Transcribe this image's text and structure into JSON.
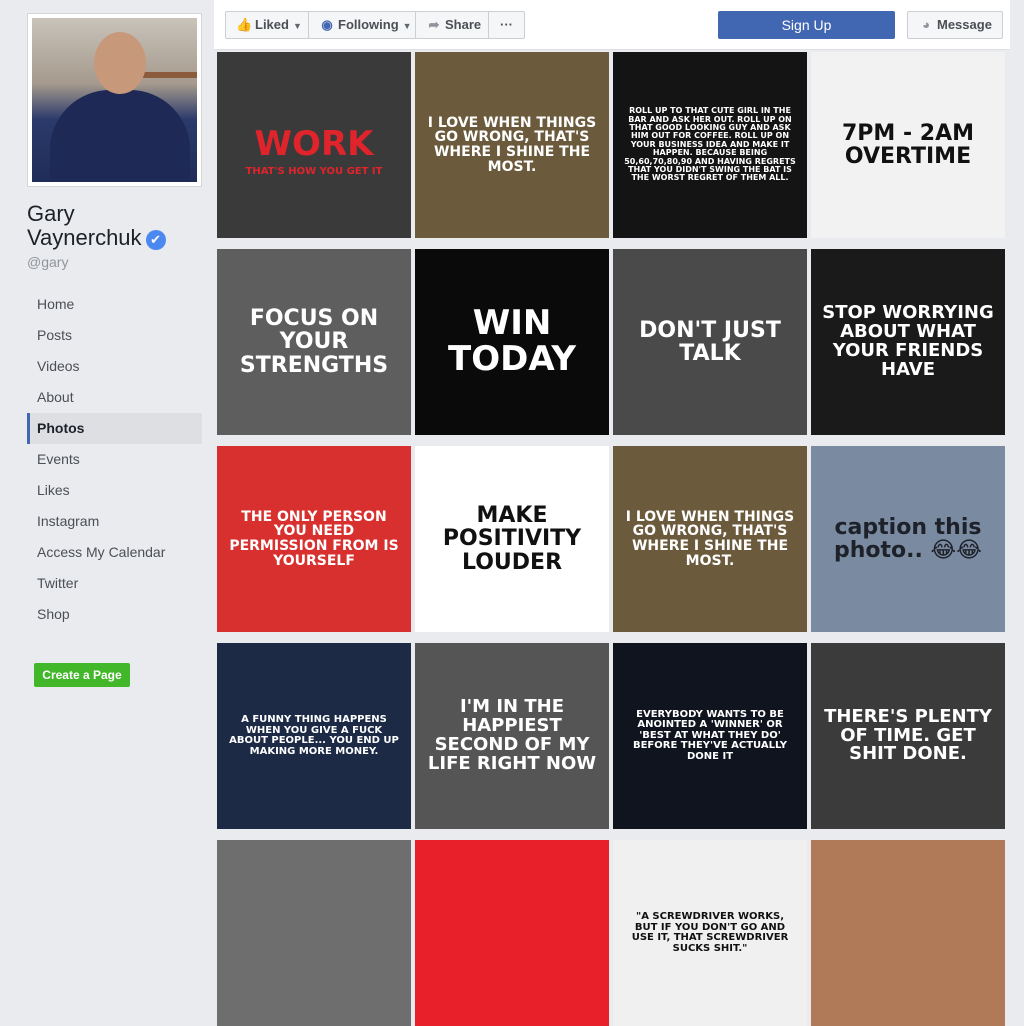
{
  "page": {
    "name_first": "Gary",
    "name_last": "Vaynerchuk",
    "handle": "@gary",
    "verified_glyph": "✔"
  },
  "nav": [
    {
      "label": "Home"
    },
    {
      "label": "Posts"
    },
    {
      "label": "Videos"
    },
    {
      "label": "About"
    },
    {
      "label": "Photos",
      "active": true
    },
    {
      "label": "Events"
    },
    {
      "label": "Likes"
    },
    {
      "label": "Instagram"
    },
    {
      "label": "Access My Calendar"
    },
    {
      "label": "Twitter"
    },
    {
      "label": "Shop"
    }
  ],
  "create_page_label": "Create a Page",
  "toolbar": {
    "liked_label": "Liked",
    "following_label": "Following",
    "share_label": "Share",
    "more_label": "···",
    "signup_label": "Sign Up",
    "message_label": "Message"
  },
  "photos": [
    {
      "text": "WORK",
      "sub": "THAT'S HOW YOU GET IT",
      "bg": "#3a3a3a",
      "color": "#e0242b"
    },
    {
      "text": "I LOVE WHEN THINGS GO WRONG, THAT'S WHERE I SHINE THE MOST.",
      "bg": "#6b5a3c",
      "color": "#ffffff"
    },
    {
      "text": "ROLL UP TO THAT CUTE GIRL IN THE BAR AND ASK HER OUT. ROLL UP ON THAT GOOD LOOKING GUY AND ASK HIM OUT FOR COFFEE. ROLL UP ON YOUR BUSINESS IDEA AND MAKE IT HAPPEN. BECAUSE BEING 50,60,70,80,90 AND HAVING REGRETS THAT YOU DIDN'T SWING THE BAT IS THE WORST REGRET OF THEM ALL.",
      "bg": "#141414",
      "color": "#ffffff"
    },
    {
      "text": "7PM - 2AM OVERTIME",
      "bg": "#f2f2f2",
      "color": "#111111"
    },
    {
      "text": "FOCUS ON YOUR STRENGTHS",
      "bg": "#5e5e5e",
      "color": "#ffffff"
    },
    {
      "text": "WIN TODAY",
      "bg": "#0a0a0a",
      "color": "#ffffff"
    },
    {
      "text": "DON'T JUST TALK",
      "bg": "#4a4a4a",
      "color": "#ffffff"
    },
    {
      "text": "STOP WORRYING ABOUT WHAT YOUR FRIENDS HAVE",
      "bg": "#1a1a1a",
      "color": "#ffffff"
    },
    {
      "text": "THE ONLY PERSON YOU NEED PERMISSION FROM IS YOURSELF",
      "bg": "#d8302e",
      "color": "#ffffff"
    },
    {
      "text": "MAKE POSITIVITY LOUDER",
      "bg": "#ffffff",
      "color": "#111111"
    },
    {
      "text": "I LOVE WHEN THINGS GO WRONG, THAT'S WHERE I SHINE THE MOST.",
      "bg": "#6b5a3c",
      "color": "#ffffff"
    },
    {
      "text": "caption this photo.. 😂😂",
      "bg": "#7a8aa0",
      "color": "#1d2129"
    },
    {
      "text": "A FUNNY THING HAPPENS WHEN YOU GIVE A FUCK ABOUT PEOPLE... YOU END UP MAKING MORE MONEY.",
      "bg": "#1c2a46",
      "color": "#ffffff"
    },
    {
      "text": "I'M IN THE HAPPIEST SECOND OF MY LIFE RIGHT NOW",
      "bg": "#555555",
      "color": "#ffffff"
    },
    {
      "text": "EVERYBODY WANTS TO BE ANOINTED A 'WINNER' OR 'BEST AT WHAT THEY DO' BEFORE THEY'VE ACTUALLY DONE IT",
      "bg": "#10141f",
      "color": "#ffffff"
    },
    {
      "text": "THERE'S PLENTY OF TIME. GET SHIT DONE.",
      "bg": "#3b3b3b",
      "color": "#ffffff"
    },
    {
      "text": "",
      "bg": "#6e6e6e",
      "color": "#ffffff"
    },
    {
      "text": "",
      "bg": "#e8202a",
      "color": "#ffffff"
    },
    {
      "text": "\"A SCREWDRIVER WORKS, BUT IF YOU DON'T GO AND USE IT, THAT SCREWDRIVER SUCKS SHIT.\"",
      "bg": "#f0f0f0",
      "color": "#111111"
    },
    {
      "text": "",
      "bg": "#b07a58",
      "color": "#ffffff"
    }
  ],
  "colors": {
    "accent": "#4267b2",
    "green": "#42b72a"
  }
}
